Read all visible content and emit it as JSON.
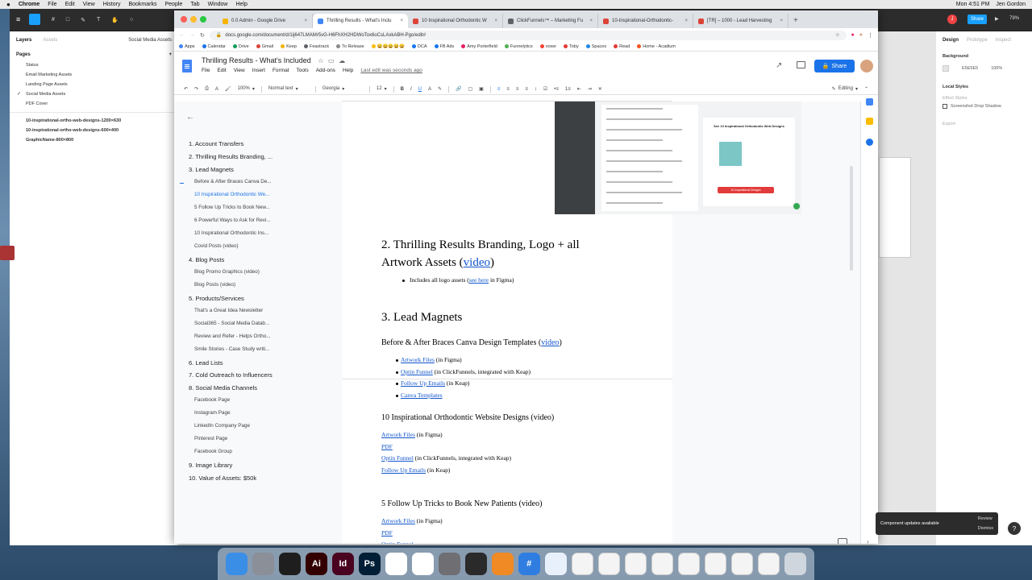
{
  "menubar": {
    "app": "Chrome",
    "menus": [
      "File",
      "Edit",
      "View",
      "History",
      "Bookmarks",
      "People",
      "Tab",
      "Window",
      "Help"
    ],
    "clock": "Mon 4:51 PM",
    "user": "Jen Gordon"
  },
  "figma": {
    "file_title": "10 Inspirational Ortho Web Designs",
    "left_tabs": {
      "layers": "Layers",
      "assets": "Assets",
      "page_select": "Social Media Assets"
    },
    "pages_header": "Pages",
    "pages": [
      "Status",
      "Email Marketing Assets",
      "Landing Page Assets",
      "Social Media Assets",
      "PDF Cover"
    ],
    "frames": [
      "10-inspirational-ortho-web-designs-1200×630",
      "10-inspirational-ortho-web-designs-600×400",
      "GraphicName-800×800"
    ],
    "right_tabs": {
      "design": "Design",
      "prototype": "Prototype",
      "inspect": "Inspect"
    },
    "background_label": "Background",
    "background_hex": "E5E5E5",
    "background_opacity": "100%",
    "local_styles": "Local Styles",
    "effect_styles": "Effect Styles",
    "effect_name": "Screenshot Drop Shadow",
    "export": "Export",
    "zoom": "79%",
    "share": "Share",
    "avatar_letter": "J",
    "toast": {
      "message": "Component updates available",
      "review": "Review",
      "dismiss": "Dismiss"
    },
    "help": "?"
  },
  "chrome": {
    "tabs": [
      {
        "label": "0.0 Admin - Google Drive",
        "color": "#f4b400"
      },
      {
        "label": "Thrilling Results - What's Inclu",
        "color": "#4285f4"
      },
      {
        "label": "10 Inspirational Orthodontic W",
        "color": "#db4437"
      },
      {
        "label": "ClickFunnels™ – Marketing Fu",
        "color": "#5f6368"
      },
      {
        "label": "10-Inspirational-Orthodontic-",
        "color": "#db4437"
      },
      {
        "label": "[TR] – 1000 - Lead Harvesting",
        "color": "#db4437"
      }
    ],
    "url": "docs.google.com/document/d/1ij647LMAMr5vG-H6FhXH2HDWoTox6oCsLAxkABH-Pgo/edit#",
    "bookmarks": [
      "Apps",
      "Calendar",
      "Drive",
      "Gmail",
      "Keep",
      "Feastrack",
      "To Release",
      "😀😀😀😀😀",
      "DCA",
      "FB Ads",
      "Amy Porterfield",
      "Funnelytics",
      "voxer",
      "Toby",
      "Spaces",
      "Read",
      "Home - Acadium"
    ]
  },
  "docs": {
    "title": "Thrilling Results - What's Included",
    "menus": [
      "File",
      "Edit",
      "View",
      "Insert",
      "Format",
      "Tools",
      "Add-ons",
      "Help"
    ],
    "last_edit": "Last edit was seconds ago",
    "share": "Share",
    "toolbar": {
      "zoom": "100%",
      "style": "Normal text",
      "font": "Georgia",
      "size": "12",
      "mode": "Editing"
    },
    "outline": [
      {
        "text": "1. Account Transfers",
        "level": 1
      },
      {
        "text": "2. Thrilling Results Branding, ...",
        "level": 1
      },
      {
        "text": "3. Lead Magnets",
        "level": 1
      },
      {
        "text": "Before & After Braces Canva De...",
        "level": 2
      },
      {
        "text": "10 Inspirational Orthodontic We...",
        "level": 2,
        "active": true
      },
      {
        "text": "5 Follow Up Tricks to Book New...",
        "level": 2
      },
      {
        "text": "6 Powerful Ways to Ask for Revi...",
        "level": 2
      },
      {
        "text": "10 Inspirational Orthodontic Ins...",
        "level": 2
      },
      {
        "text": "Covid Posts (video)",
        "level": 2
      },
      {
        "text": "4. Blog Posts",
        "level": 1
      },
      {
        "text": "Blog Promo Graphics (video)",
        "level": 2
      },
      {
        "text": "Blog Posts (video)",
        "level": 2
      },
      {
        "text": "5. Products/Services",
        "level": 1
      },
      {
        "text": "That's a Great Idea Newsletter",
        "level": 2
      },
      {
        "text": "Social365 - Social Media Datab...",
        "level": 2
      },
      {
        "text": "Review and Refer - Helps Ortho...",
        "level": 2
      },
      {
        "text": "Smile Stories - Case Study writi...",
        "level": 2
      },
      {
        "text": "6. Lead Lists",
        "level": 1
      },
      {
        "text": "7. Cold Outreach to Influencers",
        "level": 1
      },
      {
        "text": "8. Social Media Channels",
        "level": 1
      },
      {
        "text": "Facebook Page",
        "level": 2
      },
      {
        "text": "Instagram Page",
        "level": 2
      },
      {
        "text": "LinkedIn Company Page",
        "level": 2
      },
      {
        "text": "Pinterest Page",
        "level": 2
      },
      {
        "text": "Facebook Group",
        "level": 2
      },
      {
        "text": "9. Image Library",
        "level": 1
      },
      {
        "text": "10. Value of Assets: $50k",
        "level": 1
      }
    ],
    "embed": {
      "heading": "See 10 Inspirational Orthodontic Web Designs",
      "cta": "10 Inspirational Designs"
    },
    "s2": {
      "heading_a": "2. Thrilling Results Branding, Logo + all",
      "heading_b": "Artwork Assets (",
      "video": "video",
      "heading_c": ")",
      "bullet_pre": "Includes all logo assets (",
      "bullet_link": "see here",
      "bullet_post": " in Figma)"
    },
    "s3": {
      "heading": "3. Lead Magnets"
    },
    "s3a": {
      "heading_pre": "Before & After Braces Canva Design Templates (",
      "video": "video",
      "heading_post": ")",
      "items": [
        {
          "link": "Artwork Files",
          "rest": " (in Figma)"
        },
        {
          "link": "Optin Funnel",
          "rest": "  (in ClickFunnels, integrated with Keap)"
        },
        {
          "link": "Follow Up Emails",
          "rest": " (in Keap)"
        },
        {
          "link": "Canva Templates",
          "rest": ""
        }
      ]
    },
    "s3b": {
      "heading": "10 Inspirational Orthodontic Website Designs (video)",
      "items": [
        {
          "link": "Artwork Files",
          "rest": " (in Figma)"
        },
        {
          "link": "PDF",
          "rest": ""
        },
        {
          "link": "Optin Funnel",
          "rest": " (in ClickFunnels, integrated with Keap)"
        },
        {
          "link": "Follow Up Emails",
          "rest": " (in Keap)"
        }
      ]
    },
    "s3c": {
      "heading": "5 Follow Up Tricks to Book New Patients (video)",
      "items": [
        {
          "link": "Artwork Files",
          "rest": " (in Figma)"
        },
        {
          "link": "PDF",
          "rest": ""
        },
        {
          "link": "Optin Funnel",
          "rest": ""
        },
        {
          "link": "Follow Up Emails",
          "rest": " (in Keap)"
        }
      ]
    }
  },
  "dock": {
    "apps": [
      {
        "name": "finder-icon",
        "color": "#3b8ee6",
        "glyph": ""
      },
      {
        "name": "launchpad-icon",
        "color": "#8a8f98",
        "glyph": ""
      },
      {
        "name": "figma-icon",
        "color": "#1e1e1e",
        "glyph": ""
      },
      {
        "name": "illustrator-icon",
        "color": "#330000",
        "glyph": "Ai"
      },
      {
        "name": "indesign-icon",
        "color": "#49021f",
        "glyph": "Id"
      },
      {
        "name": "photoshop-icon",
        "color": "#001e36",
        "glyph": "Ps"
      },
      {
        "name": "slack-icon",
        "color": "#ffffff",
        "glyph": ""
      },
      {
        "name": "chrome-icon",
        "color": "#ffffff",
        "glyph": ""
      },
      {
        "name": "system-preferences-icon",
        "color": "#6e6e73",
        "glyph": ""
      },
      {
        "name": "notes-app-icon",
        "color": "#2a2a2a",
        "glyph": ""
      },
      {
        "name": "books-icon",
        "color": "#f08a24",
        "glyph": ""
      },
      {
        "name": "hashtag-app-icon",
        "color": "#2f7de1",
        "glyph": "#"
      },
      {
        "name": "messages-icon",
        "color": "#e8f1fb",
        "glyph": ""
      }
    ]
  }
}
